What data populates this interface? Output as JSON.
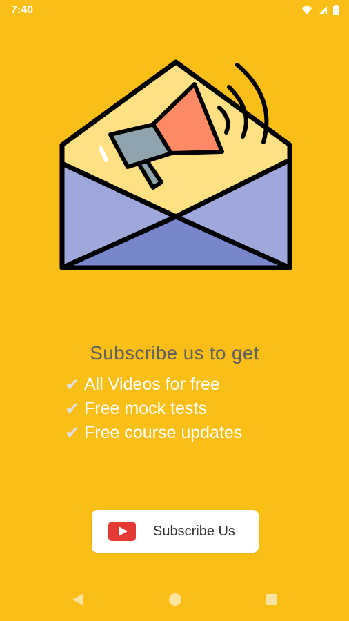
{
  "status_bar": {
    "time": "7:40",
    "icons": [
      "wifi-icon",
      "signal-icon",
      "battery-icon"
    ]
  },
  "illustration": {
    "icon": "envelope-megaphone-icon"
  },
  "promo": {
    "headline": "Subscribe us to get",
    "features": [
      {
        "icon": "checkmark-icon",
        "text": "All Videos for free"
      },
      {
        "icon": "checkmark-icon",
        "text": "Free mock tests"
      },
      {
        "icon": "checkmark-icon",
        "text": "Free course updates"
      }
    ],
    "check_glyph": "✔"
  },
  "subscribe_button": {
    "icon": "youtube-icon",
    "label": "Subscribe Us"
  },
  "nav": {
    "buttons": [
      "back-icon",
      "home-icon",
      "recents-icon"
    ]
  },
  "colors": {
    "background": "#F9BF16",
    "envelope_flap": "#FFE082",
    "envelope_body": "#9FA8DA",
    "envelope_bottom": "#7986CB",
    "megaphone": "#FF8A65",
    "youtube_red": "#E53935"
  }
}
